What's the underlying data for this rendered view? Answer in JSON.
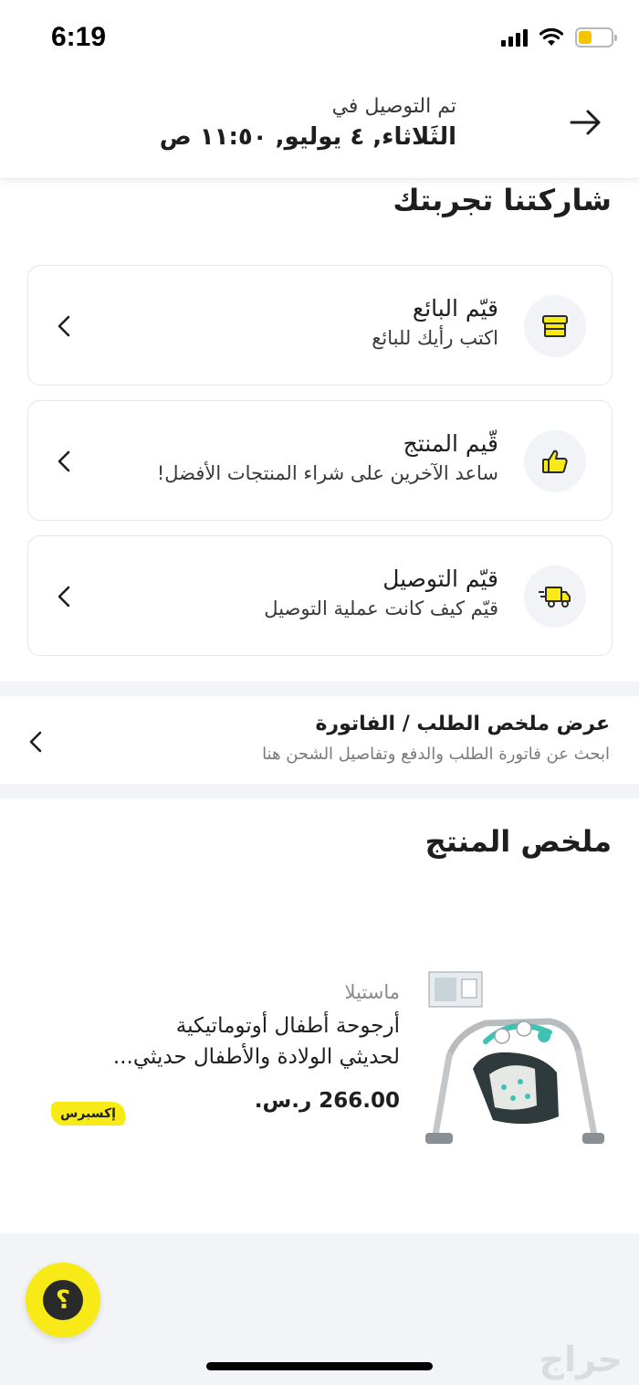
{
  "status_bar": {
    "time": "6:19"
  },
  "header": {
    "subtitle": "تم التوصيل في",
    "date": "الثَلاثاء, ٤ يوليو, ١١:٥٠ ص",
    "back_icon": "arrow-right-icon"
  },
  "feedback": {
    "title": "شاركتنا تجربتك",
    "cards": [
      {
        "title": "قيّم البائع",
        "subtitle": "اكتب رأيك للبائع",
        "icon": "store-icon"
      },
      {
        "title": "قّيم المنتج",
        "subtitle": "ساعد الآخرين على شراء المنتجات الأفضل!",
        "icon": "thumbs-up-icon"
      },
      {
        "title": "قيّم التوصيل",
        "subtitle": "قيّم كيف كانت عملية التوصيل",
        "icon": "delivery-truck-icon"
      }
    ]
  },
  "invoice": {
    "title": "عرض ملخص الطلب / الفاتورة",
    "subtitle": "ابحث عن فاتورة الطلب والدفع وتفاصيل الشحن هنا"
  },
  "product_summary": {
    "title": "ملخص المنتج",
    "product": {
      "brand": "ماستيلا",
      "name_line1": "أرجوحة أطفال أوتوماتيكية",
      "name_line2": "لحديثي الولادة والأطفال حديثي...",
      "price": "266.00 ر.س.",
      "badge": "إكسبرس"
    }
  },
  "help": {
    "label": "؟"
  },
  "watermark": "حراج",
  "colors": {
    "accent_yellow": "#f7ea16",
    "icon_bg": "#f2f3f7",
    "band_gray": "#f3f4f8",
    "battery_yellow": "#f5c400"
  }
}
